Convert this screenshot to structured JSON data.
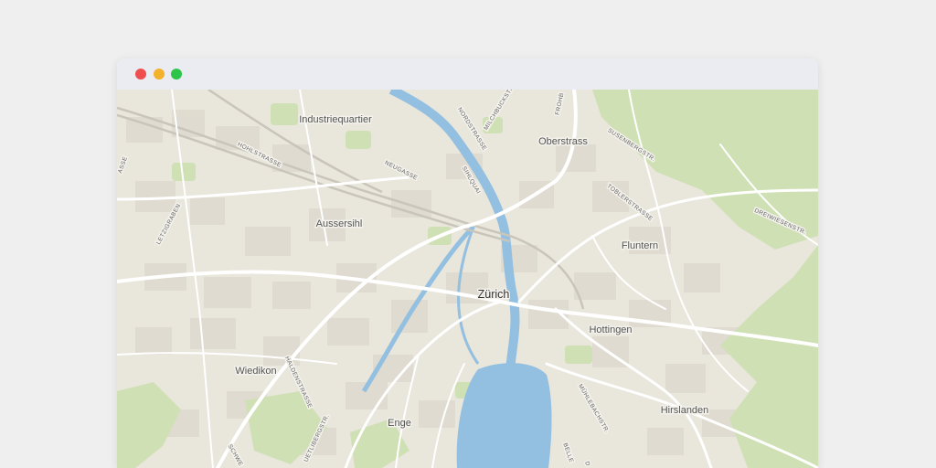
{
  "window": {
    "controls": [
      {
        "name": "close",
        "color": "#ee4e4e"
      },
      {
        "name": "minimize",
        "color": "#f4b12c"
      },
      {
        "name": "maximize",
        "color": "#2dc44a"
      }
    ]
  },
  "map": {
    "colors": {
      "land": "#e9e6dc",
      "block": "#dcd8cc",
      "park": "#cfe0b4",
      "water": "#93bfe0",
      "road": "#ffffff",
      "rail": "#c9c5bb"
    },
    "city": "Zürich",
    "districts": {
      "industriequartier": "Industriequartier",
      "oberstrass": "Oberstrass",
      "aussersihl": "Aussersihl",
      "fluntern": "Fluntern",
      "hottingen": "Hottingen",
      "wiedikon": "Wiedikon",
      "hirslanden": "Hirslanden",
      "enge": "Enge"
    },
    "streets": {
      "hohlstrasse": "HOHLSTRASSE",
      "neugasse": "NEUGASSE",
      "nordstrasse": "NORDSTRASSE",
      "milchbuckstr": "MILCHBUCKSTR.",
      "frohburg": "FROHB",
      "sihlquai": "SIHLQUAI",
      "susenbergstr": "SUSENBERGSTR.",
      "toblerstrasse": "TOBLERSTRASSE",
      "dreiwiesenstr": "DREIWIESENSTR.",
      "letzigraben": "LETZIGRABEN",
      "badenerstrasse": "ASSE",
      "haldenstrasse": "HALDENSTRASSE",
      "uetlibergstr": "UETLIBERGSTR.",
      "muehlebachstr": "MÜHLEBACHSTR.",
      "bellerive": "BELLE",
      "schweighof": "SCHWE",
      "dufourstr": "D"
    }
  }
}
